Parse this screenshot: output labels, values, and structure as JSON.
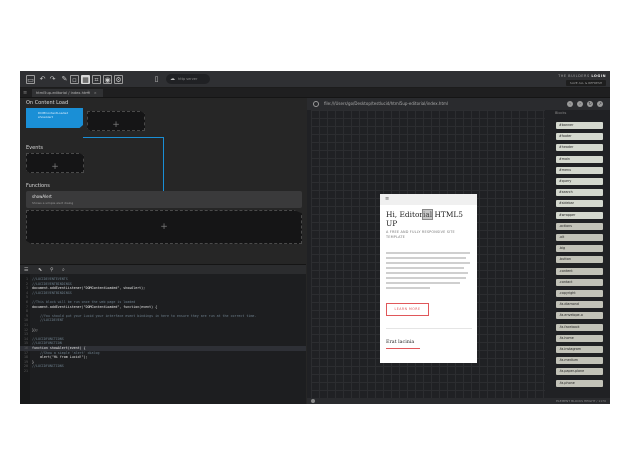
{
  "toolbar": {
    "icons": [
      "layout-icon",
      "undo-icon",
      "redo-icon",
      "pen-icon",
      "box-icon",
      "grid-icon",
      "code-icon",
      "eye-icon",
      "settings-icon",
      "device-icon"
    ],
    "search_text": "http server",
    "brand_text": "THE BUILDERS",
    "brand_user": "LOGIN",
    "save_label": "SAVE ALL & REFRESH"
  },
  "tabs": {
    "active": "html5up-editorial / index.html",
    "close": "×",
    "add": "+",
    "menu": "≡"
  },
  "blocks_pane": {
    "on_content_load_title": "On Content Load",
    "onload_tile_line1": "DOMContentLoaded",
    "onload_tile_line2": "showAlert",
    "events_title": "Events",
    "functions_title": "Functions",
    "plus": "+",
    "function_name": "showAlert",
    "function_desc": "Shows a simple alert dialog"
  },
  "code_toolbar": {
    "icons": [
      "list-icon",
      "cursor-icon",
      "link-icon",
      "search-icon"
    ]
  },
  "code_lines": [
    {
      "n": "1",
      "t": "//LUCIDEVENTEVENTS",
      "k": "com"
    },
    {
      "n": "2",
      "t": "//LUCIDEVENTBINDINGS",
      "k": "com"
    },
    {
      "n": "3",
      "t": "document.addEventListener(\"DOMContentLoaded\", showAlert);",
      "k": "code"
    },
    {
      "n": "4",
      "t": "//LUCIDEVENTBINDINGS",
      "k": "com"
    },
    {
      "n": "5",
      "t": "",
      "k": "code"
    },
    {
      "n": "6",
      "t": "//This block will be run once the web page is loaded",
      "k": "com"
    },
    {
      "n": "7",
      "t": "document.addEventListener(\"DOMContentLoaded\", function(event) {",
      "k": "code"
    },
    {
      "n": "8",
      "t": "",
      "k": "code"
    },
    {
      "n": "9",
      "t": "    //You should put your Lucid your interface event bindings in here to ensure they are run at the correct time.",
      "k": "com"
    },
    {
      "n": "10",
      "t": "    //LUCIDEVENT",
      "k": "com"
    },
    {
      "n": "11",
      "t": "",
      "k": "code"
    },
    {
      "n": "12",
      "t": "});",
      "k": "code"
    },
    {
      "n": "13",
      "t": "",
      "k": "code"
    },
    {
      "n": "14",
      "t": "//LUCIDFUNCTIONS",
      "k": "com"
    },
    {
      "n": "15",
      "t": "//LUCIDFUNCTION",
      "k": "com"
    },
    {
      "n": "16",
      "t": "function showAlert(event) {",
      "k": "code"
    },
    {
      "n": "17",
      "t": "    //Show a simple 'alert' dialog",
      "k": "com"
    },
    {
      "n": "18",
      "t": "    alert(\"Hi from Lucid!\");",
      "k": "code"
    },
    {
      "n": "19",
      "t": "}",
      "k": "code"
    },
    {
      "n": "20",
      "t": "//LUCIDFUNCTIONS",
      "k": "com"
    },
    {
      "n": "21",
      "t": "",
      "k": "code"
    }
  ],
  "preview": {
    "url": "file:///Users/go/Desktop/testlucid/html5up-editorial/index.html",
    "menu_icon": "≡",
    "title_pre": "Hi, Editor",
    "title_sel": "ial",
    "title_post": " HTML5 UP",
    "subtitle": "A FREE AND FULLY RESPONSIVE SITE TEMPLATE",
    "button": "LEARN MORE",
    "heading2": "Erat lacinia"
  },
  "blocks_list": {
    "title": "Blocks",
    "items": [
      "#banner",
      "#footer",
      "#header",
      "#main",
      "#menu",
      "#query",
      "#search",
      "#sidebar",
      "#wrapper",
      ".actions",
      ".alt",
      ".big",
      ".button",
      ".content",
      ".contact",
      ".copyright",
      ".fa-diamond",
      ".fa-envelope-o",
      ".fa-facebook",
      ".fa-home",
      ".fa-instagram",
      ".fa-medium",
      ".fa-paper-plane",
      ".fa-phone"
    ]
  },
  "status": {
    "text": "ELEMENT BLOCKS  HEIGHT / 1170"
  },
  "colors": {
    "accent": "#1a8fd6",
    "brand_red": "#e0575a",
    "block_bg": "#d4d8ce"
  }
}
